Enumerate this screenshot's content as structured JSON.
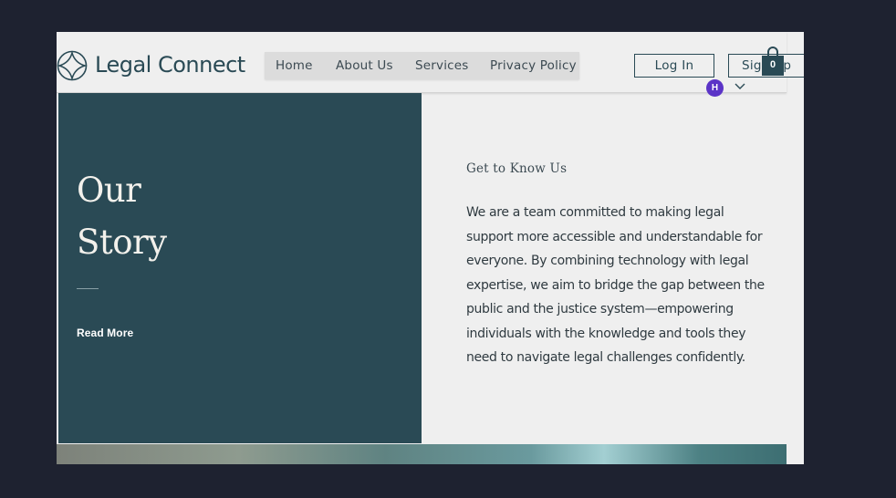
{
  "brand": {
    "name": "Legal Connect",
    "logo_icon": "cross-circle-logo"
  },
  "nav": {
    "items": [
      {
        "label": "Home"
      },
      {
        "label": "About Us"
      },
      {
        "label": "Services"
      },
      {
        "label": "Privacy Policy"
      }
    ]
  },
  "auth": {
    "login_label": "Log In",
    "signup_label": "Sign Up"
  },
  "cart": {
    "count": "0",
    "icon": "shopping-bag-icon"
  },
  "user": {
    "initial": "H",
    "avatar_color": "#5b34c7"
  },
  "story": {
    "title_line1": "Our",
    "title_line2": "Story",
    "read_more": "Read More"
  },
  "about": {
    "kicker": "Get to Know Us",
    "body": "We are a team committed to making legal support more accessible and understandable for everyone. By combining technology with legal expertise, we aim to bridge the gap between the public and the justice system—empowering individuals with the knowledge and tools they need to navigate legal challenges confidently."
  },
  "colors": {
    "background": "#1e2230",
    "page": "#efefef",
    "accent": "#2a4a55"
  }
}
